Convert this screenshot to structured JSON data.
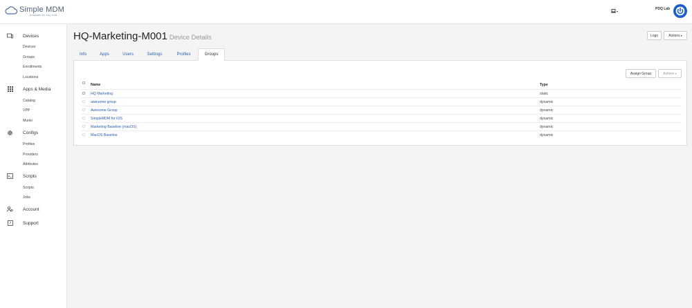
{
  "brand": {
    "name": "Simple MDM",
    "tagline": "POWERED BY PDQ.COM"
  },
  "header": {
    "org_name": "PDQ Lab",
    "notifications_icon": "laptop-icon"
  },
  "sidebar": {
    "sections": [
      {
        "label": "Devices",
        "icon": "devices-icon",
        "items": [
          "Devices",
          "Groups",
          "Enrollments",
          "Locations"
        ]
      },
      {
        "label": "Apps & Media",
        "icon": "grid-icon",
        "items": [
          "Catalog",
          "VPP",
          "Munki"
        ]
      },
      {
        "label": "Configs",
        "icon": "gear-icon",
        "items": [
          "Profiles",
          "Providers",
          "Attributes"
        ]
      },
      {
        "label": "Scripts",
        "icon": "terminal-icon",
        "items": [
          "Scripts",
          "Jobs"
        ]
      },
      {
        "label": "Account",
        "icon": "account-icon",
        "items": []
      },
      {
        "label": "Support",
        "icon": "support-icon",
        "items": []
      }
    ]
  },
  "page": {
    "title": "HQ-Marketing-M001",
    "subtitle": "Device Details",
    "logs_label": "Logs",
    "actions_label": "Actions"
  },
  "tabs": [
    "Info",
    "Apps",
    "Users",
    "Settings",
    "Profiles",
    "Groups"
  ],
  "active_tab": "Groups",
  "groups_panel": {
    "assign_label": "Assign Group",
    "actions_label": "Actions",
    "columns": {
      "name": "Name",
      "type": "Type"
    },
    "rows": [
      {
        "name": "HQ Marketing",
        "type": "static"
      },
      {
        "name": "awesome group",
        "type": "dynamic"
      },
      {
        "name": "Awesome Group",
        "type": "dynamic"
      },
      {
        "name": "SimpleMDM for iOS",
        "type": "dynamic"
      },
      {
        "name": "Marketing Baseline (macOS)",
        "type": "dynamic"
      },
      {
        "name": "MacOS Baseline",
        "type": "dynamic"
      }
    ]
  },
  "colors": {
    "link": "#2a5db0",
    "brand_blue": "#1a5fc9"
  }
}
